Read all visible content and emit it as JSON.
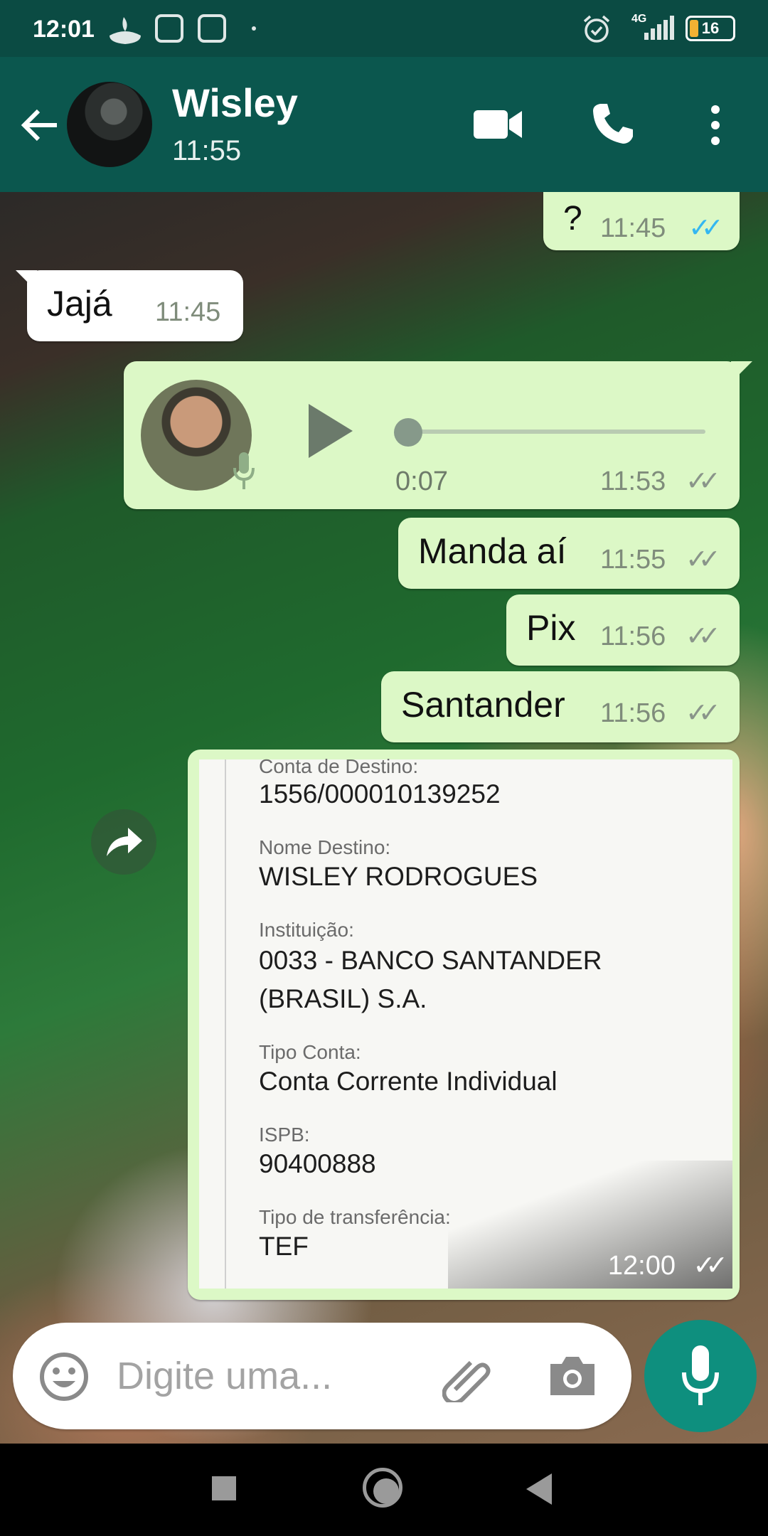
{
  "status_bar": {
    "time": "12:01",
    "network": "4G",
    "battery": "16"
  },
  "header": {
    "contact_name": "Wisley",
    "contact_status": "11:55"
  },
  "messages": [
    {
      "type": "out",
      "text": "?",
      "time": "11:45",
      "ticks": "✓✓",
      "read": true
    },
    {
      "type": "in",
      "text": "Jajá",
      "time": "11:45"
    },
    {
      "type": "out-voice",
      "duration": "0:07",
      "time": "11:53",
      "ticks": "✓✓"
    },
    {
      "type": "out",
      "text": "Manda aí",
      "time": "11:55",
      "ticks": "✓✓"
    },
    {
      "type": "out",
      "text": "Pix",
      "time": "11:56",
      "ticks": "✓✓"
    },
    {
      "type": "out",
      "text": "Santander",
      "time": "11:56",
      "ticks": "✓✓"
    },
    {
      "type": "out-image",
      "time": "12:00",
      "ticks": "✓✓"
    }
  ],
  "receipt": {
    "fields": [
      {
        "label": "Conta de Destino:",
        "value": "1556/000010139252"
      },
      {
        "label": "Nome Destino:",
        "value": "WISLEY RODROGUES"
      },
      {
        "label": "Instituição:",
        "value": "0033 - BANCO SANTANDER",
        "value2": "(BRASIL) S.A."
      },
      {
        "label": "Tipo Conta:",
        "value": "Conta Corrente Individual"
      },
      {
        "label": "ISPB:",
        "value": "90400888"
      },
      {
        "label": "Tipo de transferência:",
        "value": "TEF"
      }
    ]
  },
  "input": {
    "placeholder": "Digite uma..."
  },
  "icons": {
    "back": "arrow-left-icon",
    "video": "video-call-icon",
    "call": "phone-icon",
    "menu": "more-vert-icon",
    "emoji": "emoji-icon",
    "attach": "paperclip-icon",
    "camera": "camera-icon",
    "mic": "mic-icon",
    "play": "play-icon",
    "forward": "forward-icon"
  },
  "colors": {
    "header": "#0b574e",
    "status_bar": "#0b4b43",
    "outgoing": "#dcf8c6",
    "incoming": "#ffffff",
    "fab": "#0e8f7e",
    "read_ticks": "#34b7f1"
  }
}
